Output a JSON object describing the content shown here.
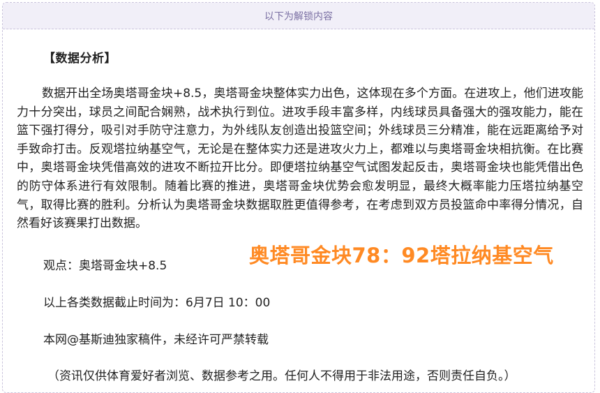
{
  "unlock_bar": {
    "label": "以下为解锁内容"
  },
  "article": {
    "heading": "【数据分析】",
    "paragraph": "数据开出全场奥塔哥金块+8.5，奥塔哥金块整体实力出色，这体现在多个方面。在进攻上，他们进攻能力十分突出，球员之间配合娴熟，战术执行到位。进攻手段丰富多样，内线球员具备强大的强攻能力，能在篮下强打得分，吸引对手防守注意力，为外线队友创造出投篮空间；外线球员三分精准，能在远距离给予对手致命打击。反观塔拉纳基空气，无论是在整体实力还是进攻火力上，都难以与奥塔哥金块相抗衡。在比赛中，奥塔哥金块凭借高效的进攻不断拉开比分。即便塔拉纳基空气试图发起反击，奥塔哥金块也能凭借出色的防守体系进行有效限制。随着比赛的推进，奥塔哥金块优势会愈发明显，最终大概率能力压塔拉纳基空气，取得比赛的胜利。分析认为奥塔哥金块数据取胜更值得参考，在考虑到双方员投篮命中率得分情况，自然看好该赛果打出数据。",
    "viewpoint": "观点：奥塔哥金块+8.5",
    "cutoff": "以上各类数据截止时间为：6月7日 10：00",
    "copyright": "本网@基斯迪独家稿件，未经许可严禁转载",
    "disclaimer": "（资讯仅供体育爱好者浏览、数据参考之用。任何人不得用于非法用途，否则责任自负。）"
  },
  "score_overlay": {
    "text": "奥塔哥金块78：92塔拉纳基空气",
    "color": "#ff8a24"
  }
}
